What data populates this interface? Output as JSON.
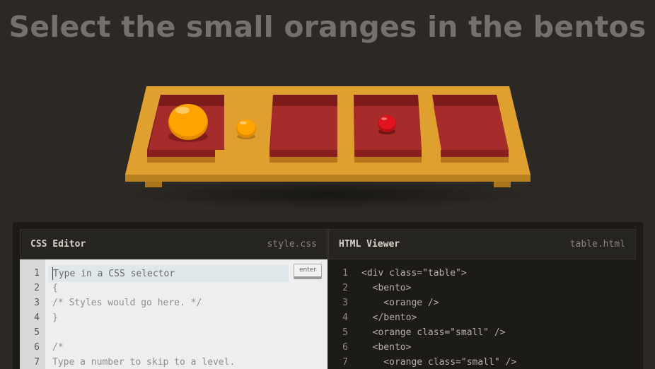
{
  "level": {
    "instruction": "Select the small oranges in the bentos"
  },
  "table_items": [
    {
      "type": "bento",
      "contains": "orange"
    },
    {
      "type": "orange",
      "size": "small"
    },
    {
      "type": "bento",
      "contains": "none"
    },
    {
      "type": "bento",
      "contains": "apple",
      "size": "small"
    },
    {
      "type": "bento",
      "contains": "none"
    }
  ],
  "colors": {
    "background": "#2c2925",
    "table": "#e0a030",
    "bento": "#a62b2b",
    "orange": "#ffa300",
    "apple": "#e0141e"
  },
  "css_editor": {
    "title": "CSS Editor",
    "filename": "style.css",
    "input_placeholder": "Type in a CSS selector",
    "enter_label": "enter",
    "line_numbers": [
      "1",
      "2",
      "3",
      "4",
      "5",
      "6",
      "7"
    ],
    "lines": [
      "",
      "{",
      "/* Styles would go here. */",
      "}",
      "",
      "/*",
      "Type a number to skip to a level."
    ]
  },
  "html_viewer": {
    "title": "HTML Viewer",
    "filename": "table.html",
    "line_numbers": [
      "1",
      "2",
      "3",
      "4",
      "5",
      "6",
      "7"
    ],
    "lines": [
      "<div class=\"table\">",
      "  <bento>",
      "    <orange />",
      "  </bento>",
      "  <orange class=\"small\" />",
      "  <bento>",
      "    <orange class=\"small\" />"
    ]
  }
}
